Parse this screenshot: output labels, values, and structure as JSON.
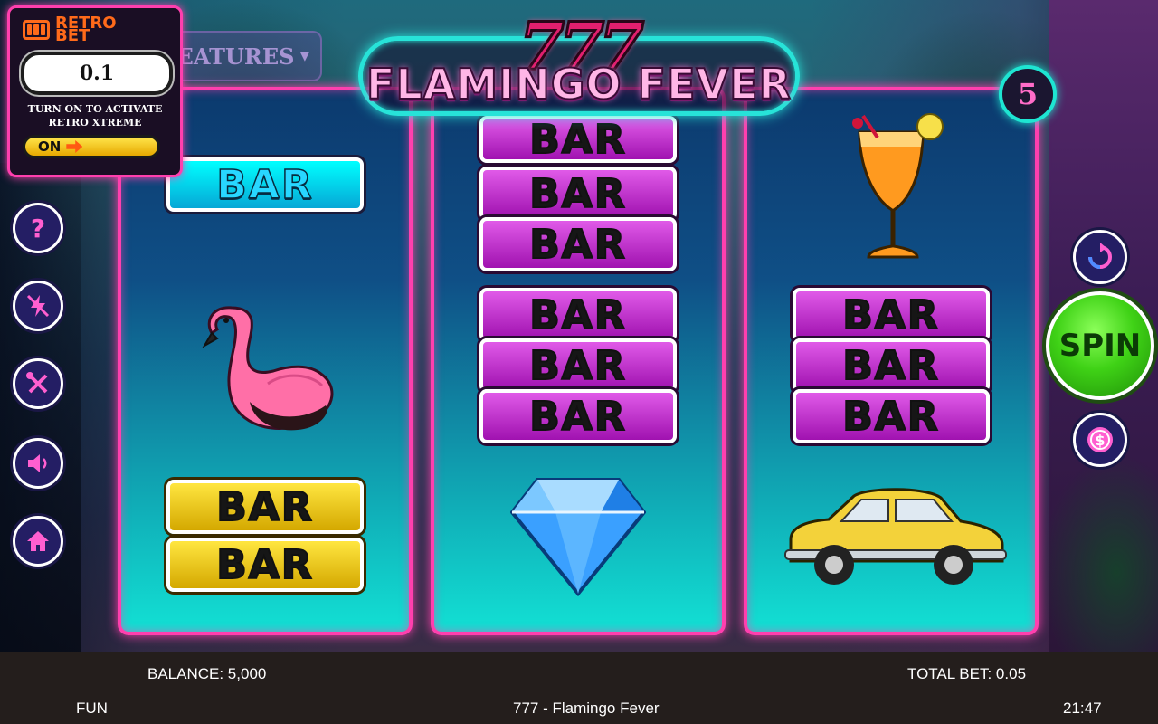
{
  "brand": {
    "name": "RETRO BET"
  },
  "hud": {
    "bet_value": "0.1",
    "note_line1": "TURN ON TO ACTIVATE",
    "note_line2": "RETRO XTREME",
    "toggle_label": "ON"
  },
  "features_label": "FEATURES",
  "title": {
    "top": "777",
    "main": "FLAMINGO FEVER"
  },
  "lines_count": "5",
  "side_buttons": [
    {
      "icon": "question-icon",
      "glyph": "?"
    },
    {
      "icon": "turbo-icon",
      "glyph": "⚡"
    },
    {
      "icon": "settings-icon",
      "glyph": "✕"
    },
    {
      "icon": "sound-icon",
      "glyph": "🔊"
    },
    {
      "icon": "home-icon",
      "glyph": "⌂"
    }
  ],
  "reels": {
    "reel1": {
      "bar_blue": "BAR",
      "bar_yellow_1": "BAR",
      "bar_yellow_2": "BAR"
    },
    "reel2": {
      "bar_top": "BAR",
      "bar_a": "BAR",
      "bar_b": "BAR",
      "bar_c": "BAR",
      "bar_d": "BAR",
      "bar_e": "BAR"
    },
    "reel3": {
      "bar_1": "BAR",
      "bar_2": "BAR",
      "bar_3": "BAR"
    }
  },
  "symbols": [
    "bar-blue",
    "flamingo",
    "triple-bar",
    "cocktail",
    "diamond",
    "yellow-car",
    "double-bar"
  ],
  "spin_label": "SPIN",
  "bottom_bar": {
    "balance": "BALANCE: 5,000",
    "total_bet": "TOTAL BET: 0.05",
    "mode": "FUN",
    "game_name": "777 - Flamingo Fever",
    "clock": "21:47"
  },
  "colors": {
    "neon_pink": "#ff3fae",
    "neon_cyan": "#27e3d8",
    "spin_green": "#3fd216",
    "bar_pink": "#c02ed0",
    "bar_yellow": "#f0c800"
  }
}
